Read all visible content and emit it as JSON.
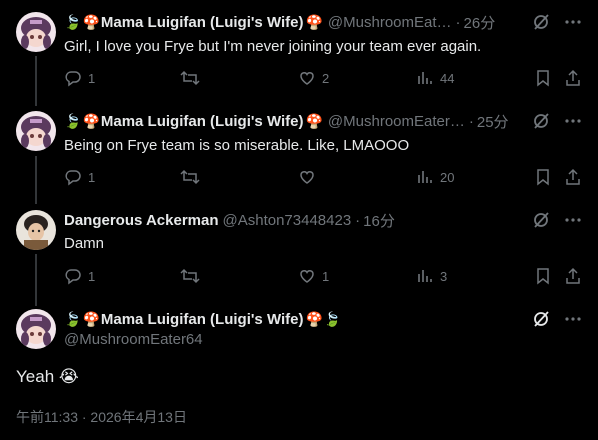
{
  "posts": [
    {
      "name": "Mama Luigifan (Luigi's Wife)",
      "handle": "@MushroomEat…",
      "time": "26分",
      "text": "Girl, I love you Frye but I'm never joining your team ever again.",
      "replies": "1",
      "reposts": "",
      "likes": "2",
      "views": "44"
    },
    {
      "name": "Mama Luigifan (Luigi's Wife)",
      "handle": "@MushroomEater…",
      "time": "25分",
      "text": "Being on Frye team is so miserable. Like, LMAOOO",
      "replies": "1",
      "reposts": "",
      "likes": "",
      "views": "20"
    },
    {
      "name": "Dangerous Ackerman",
      "handle": "@Ashton73448423",
      "time": "16分",
      "text": "Damn",
      "replies": "1",
      "reposts": "",
      "likes": "1",
      "views": "3"
    }
  ],
  "main_post": {
    "name": "Mama Luigifan (Luigi's Wife)",
    "handle": "@MushroomEater64",
    "text": "Yeah 😭",
    "timestamp": "午前11:33 · 2026年4月13日"
  },
  "decor": {
    "leaf": "🍃",
    "mushroom": "🍄"
  },
  "colors": {
    "background": "#000000",
    "text": "#e7e9ea",
    "muted": "#71767b",
    "thread_line": "#333639"
  }
}
